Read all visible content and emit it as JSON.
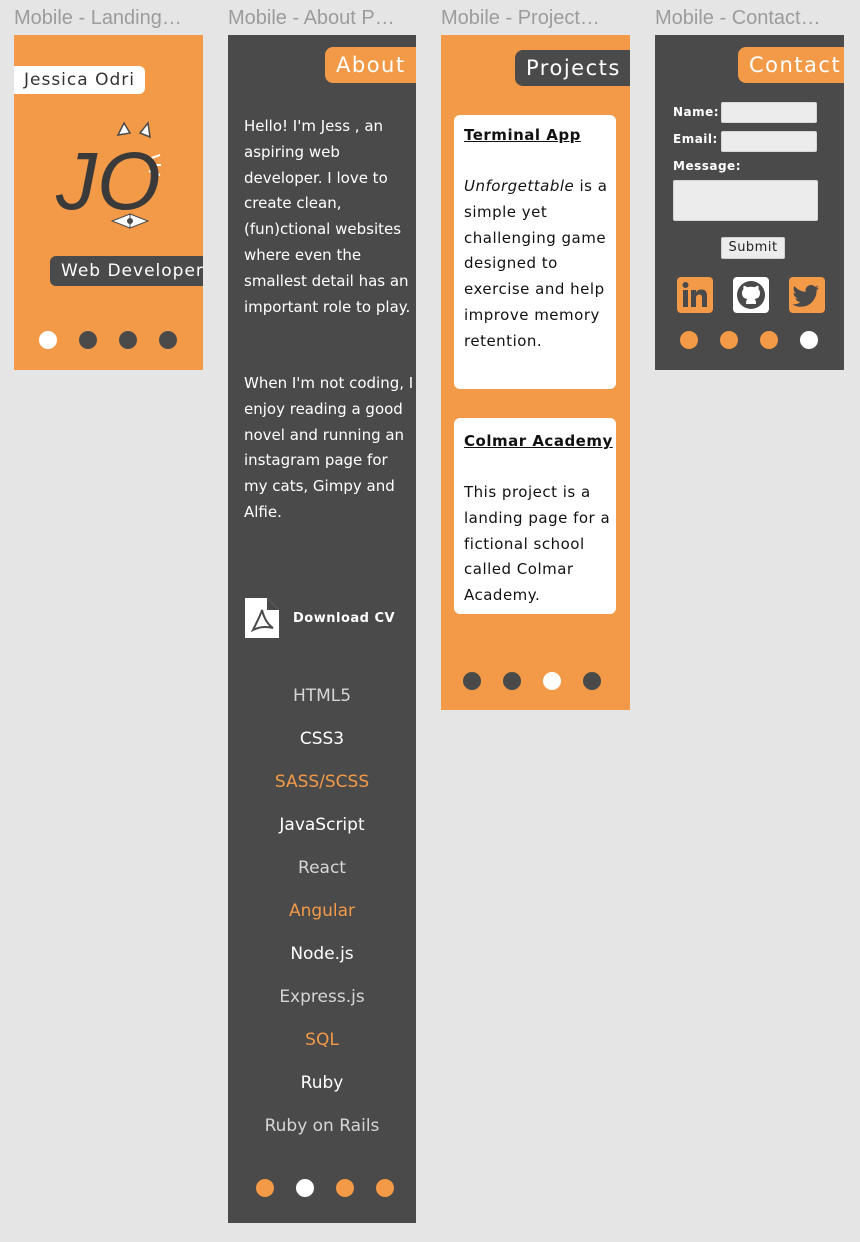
{
  "frames": [
    {
      "title": "Mobile - Landing…"
    },
    {
      "title": "Mobile - About P…"
    },
    {
      "title": "Mobile - Project…"
    },
    {
      "title": "Mobile - Contact…"
    }
  ],
  "landing": {
    "name": "Jessica Odri",
    "monogram": "JO",
    "role": "Web Developer"
  },
  "about": {
    "tab": "About",
    "para1": "Hello! I'm Jess , an aspiring web developer. I love to create clean, (fun)ctional websites where even the smallest detail has an important role to play.",
    "para2": "When I'm not coding, I enjoy reading a good novel and running an instagram page for my cats, Gimpy and Alfie.",
    "download_label": "Download CV",
    "skills": [
      "HTML5",
      "CSS3",
      "SASS/SCSS",
      "JavaScript",
      "React",
      "Angular",
      "Node.js",
      "Express.js",
      "SQL",
      "Ruby",
      "Ruby on Rails"
    ],
    "skill_colors": [
      "#d6d6d6",
      "#ffffff",
      "#f39a48",
      "#ffffff",
      "#d6d6d6",
      "#f39a48",
      "#ffffff",
      "#d6d6d6",
      "#f39a48",
      "#ffffff",
      "#d6d6d6"
    ]
  },
  "projects": {
    "tab": "Projects",
    "items": [
      {
        "title": "Terminal App",
        "emphasis": "Unforgettable",
        "desc": " is a simple yet challenging game designed to exercise and help improve memory retention."
      },
      {
        "title": "Colmar Academy",
        "desc": "This project is a landing page for a fictional school called Colmar Academy."
      }
    ]
  },
  "contact": {
    "tab": "Contact",
    "name_label": "Name:",
    "email_label": "Email:",
    "message_label": "Message:",
    "submit_label": "Submit",
    "socials": [
      "linkedin-icon",
      "github-icon",
      "twitter-icon"
    ]
  },
  "colors": {
    "orange": "#f39a48",
    "dark": "#4a4a4a",
    "bg": "#e5e5e5"
  },
  "pagination": {
    "total": 4,
    "landing_active": 1,
    "about_active": 2,
    "projects_active": 3,
    "contact_active": 4
  }
}
